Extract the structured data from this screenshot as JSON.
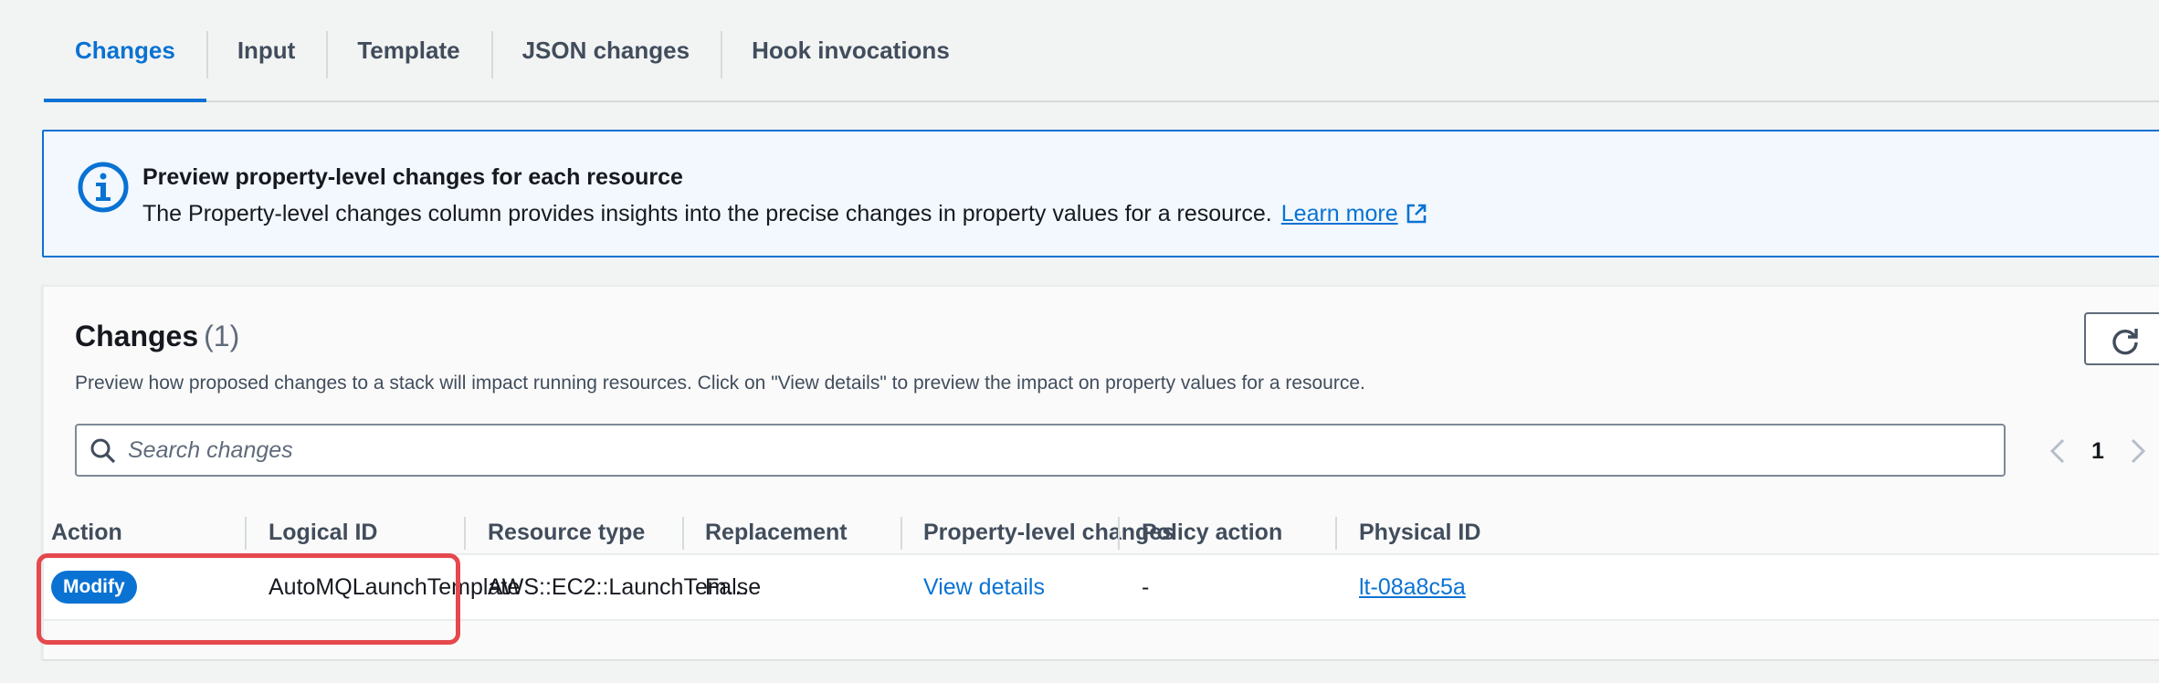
{
  "tabs": [
    {
      "label": "Changes",
      "active": true
    },
    {
      "label": "Input"
    },
    {
      "label": "Template"
    },
    {
      "label": "JSON changes"
    },
    {
      "label": "Hook invocations"
    }
  ],
  "banner": {
    "icon": "info-icon",
    "title": "Preview property-level changes for each resource",
    "text": "The Property-level changes column provides insights into the precise changes in property values for a resource.",
    "link_label": "Learn more",
    "link_icon": "external-link-icon"
  },
  "changes_panel": {
    "title": "Changes",
    "count": "(1)",
    "description": "Preview how proposed changes to a stack will impact running resources. Click on \"View details\" to preview the impact on property values for a resource.",
    "refresh_icon": "refresh-icon",
    "search": {
      "placeholder": "Search changes",
      "value": ""
    },
    "pagination": {
      "current_page": "1"
    }
  },
  "table": {
    "columns": [
      "Action",
      "Logical ID",
      "Resource type",
      "Replacement",
      "Property-level changes",
      "Policy action",
      "Physical ID"
    ],
    "rows": [
      {
        "action": "Modify",
        "logical_id": "AutoMQLaunchTemplate",
        "resource_type": "AWS::EC2::LaunchTem…",
        "replacement": "False",
        "property_level_changes": "View details",
        "policy_action": "-",
        "physical_id": "lt-08a8c5a"
      }
    ]
  },
  "colors": {
    "accent": "#0972d3",
    "highlight": "#e5484d",
    "banner_bg": "#f2f8fd"
  }
}
